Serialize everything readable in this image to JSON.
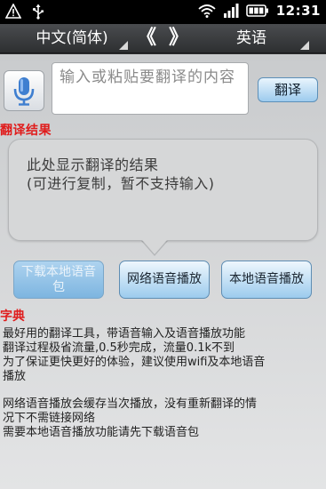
{
  "status_bar": {
    "time": "12:31",
    "left_icons": [
      "warning-icon",
      "usb-icon"
    ],
    "right_icons": [
      "wifi-icon",
      "signal-icon",
      "battery-icon"
    ]
  },
  "lang_bar": {
    "source_lang": "中文(简体)",
    "target_lang": "英语",
    "prev_symbol": "《",
    "next_symbol": "》"
  },
  "input": {
    "placeholder": "输入或粘贴要翻译的内容"
  },
  "buttons": {
    "translate": "翻译",
    "download_voice": "下载本地语音包",
    "online_voice": "网络语音播放",
    "local_voice": "本地语音播放"
  },
  "result": {
    "heading": "翻译结果",
    "placeholder_line1": "此处显示翻译的结果",
    "placeholder_line2": "(可进行复制，暂不支持输入)"
  },
  "dictionary": {
    "heading": "字典",
    "info_lines_1": [
      "最好用的翻译工具，带语音输入及语音播放功能",
      "翻译过程极省流量,0.5秒完成，流量0.1k不到",
      "为了保证更快更好的体验，建议使用wifi及本地语音",
      "播放"
    ],
    "info_lines_2": [
      "网络语音播放会缓存当次播放，没有重新翻译的情",
      "况下不需链接网络",
      "需要本地语音播放功能请先下载语音包"
    ]
  },
  "colors": {
    "heading_red": "#e01c1c",
    "button_blue": "#9dcbee",
    "status_bar": "#000000"
  }
}
